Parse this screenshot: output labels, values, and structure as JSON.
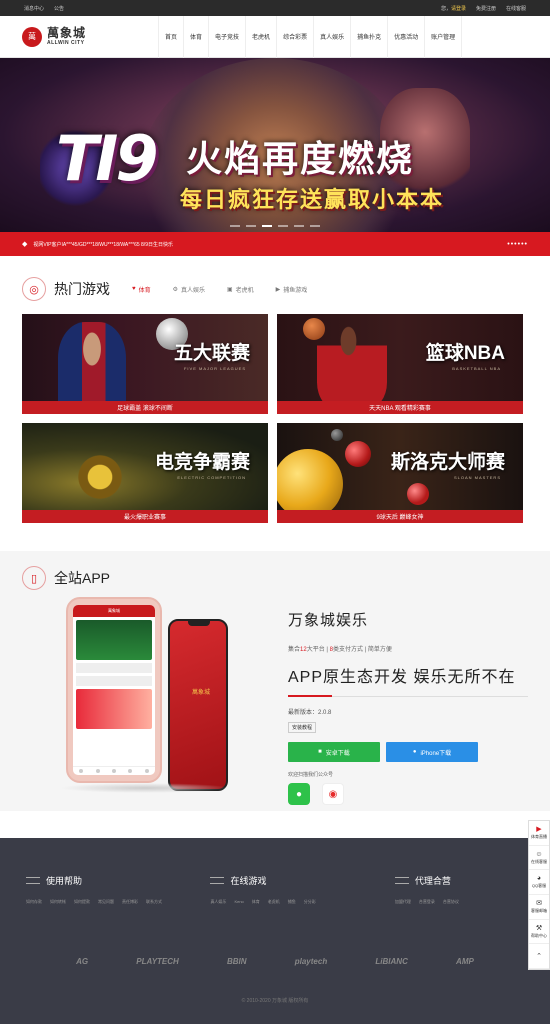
{
  "topbar": {
    "left": [
      "消息中心",
      "公告"
    ],
    "greeting": "您，",
    "login": "请登录",
    "register": "免费注册",
    "service": "在线客服"
  },
  "header": {
    "logo_cn": "萬象城",
    "logo_en": "ALLWIN CITY",
    "logo_seal": "萬",
    "nav": [
      "首页",
      "体育",
      "电子竞技",
      "老虎机",
      "综合彩票",
      "真人娱乐",
      "捕鱼扑克",
      "优惠活动",
      "账户管理"
    ]
  },
  "banner": {
    "big": "TI9",
    "title": "火焰再度燃烧",
    "subtitle": "每日疯狂存送赢取小本本"
  },
  "ticker": {
    "text": "视网VIP客户IA***45/GD***18/WU***18/WA***65 8/9日生日快乐",
    "pager": "••••••"
  },
  "hot": {
    "title": "热门游戏",
    "tabs": [
      "体育",
      "真人娱乐",
      "老虎机",
      "捕鱼游戏"
    ],
    "cards": [
      {
        "title": "五大联赛",
        "en": "FIVE MAJOR LEAGUES",
        "caption": "足球霸盖 滚球不间断"
      },
      {
        "title": "篮球NBA",
        "en": "BASKETBALL NBA",
        "caption": "天天NBA 观看精彩赛事"
      },
      {
        "title": "电竞争霸赛",
        "en": "ELECTRIC COMPETITION",
        "caption": "最火爆职业赛事"
      },
      {
        "title": "斯洛克大师赛",
        "en": "SLOAN MASTERS",
        "caption": "9球天后 巅峰女神"
      }
    ]
  },
  "app": {
    "title": "全站APP",
    "name": "万象城娱乐",
    "feat_pre": "集合",
    "feat_n1": "12",
    "feat_mid": "大平台 | ",
    "feat_n2": "8",
    "feat_post": "类支付方式 | 简单方便",
    "slogan": "APP原生态开发 娱乐无所不在",
    "version": "最新版本：2.0.8",
    "guide": "安装教程",
    "android": "安卓下载",
    "iphone": "iPhone下载",
    "follow": "欢迎扫描我们公众号",
    "phone_logo": "萬象城"
  },
  "side": [
    "体育直播",
    "在线客服",
    "QQ客服",
    "客服邮箱",
    "帮助中心",
    ""
  ],
  "footer": {
    "cols": [
      {
        "title": "使用帮助",
        "links": [
          "如何存款",
          "如何转帐",
          "如何提款",
          "常见问题",
          "责任博彩",
          "联系方式"
        ]
      },
      {
        "title": "在线游戏",
        "links": [
          "真人娱乐",
          "Keno",
          "体育",
          "老虎机",
          "捕鱼",
          "分分彩"
        ]
      },
      {
        "title": "代理合营",
        "links": [
          "加盟代理",
          "合营登录",
          "合营协议"
        ]
      }
    ],
    "partners": [
      "AG",
      "PLAYTECH",
      "BBIN",
      "playtech",
      "LiBIANC",
      "AMP"
    ],
    "copyright": "© 2010-2020 万象城 版权所有"
  }
}
